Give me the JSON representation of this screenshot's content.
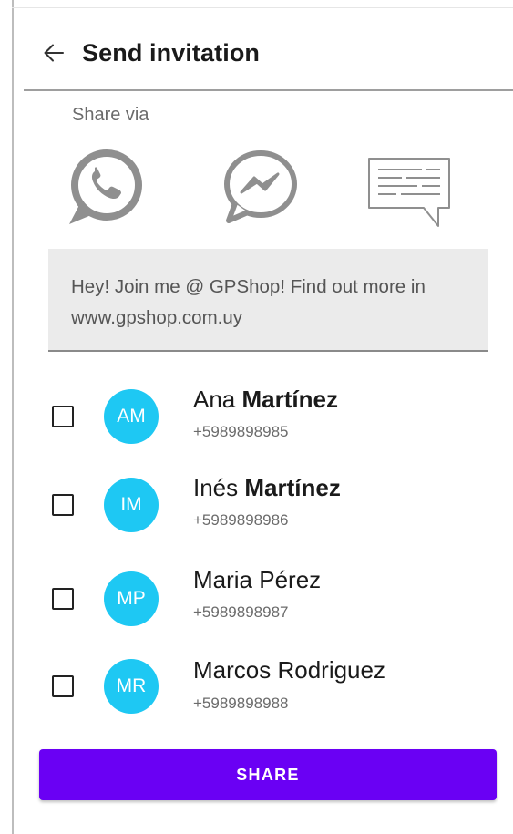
{
  "header": {
    "title": "Send invitation",
    "back_icon": "arrow-left-icon"
  },
  "share_via": {
    "label": "Share via",
    "options": [
      {
        "icon": "whatsapp-icon"
      },
      {
        "icon": "messenger-icon"
      },
      {
        "icon": "sms-message-icon"
      }
    ]
  },
  "message": {
    "text": "Hey! Join me @ GPShop! Find out more in www.gpshop.com.uy"
  },
  "contacts": [
    {
      "initials": "AM",
      "first_name": "Ana ",
      "last_name": "Martínez",
      "phone": "+5989898985",
      "checked": false
    },
    {
      "initials": "IM",
      "first_name": "Inés ",
      "last_name": "Martínez",
      "phone": "+5989898986",
      "checked": false
    },
    {
      "initials": "MP",
      "first_name": "Maria Pérez",
      "last_name": "",
      "phone": "+5989898987",
      "checked": false
    },
    {
      "initials": "MR",
      "first_name": "Marcos Rodriguez",
      "last_name": "",
      "phone": "+5989898988",
      "checked": false
    }
  ],
  "colors": {
    "accent": "#6a00f4",
    "avatar": "#1ec8f3",
    "icon_gray": "#8f8f8f"
  },
  "actions": {
    "share_label": "SHARE"
  }
}
